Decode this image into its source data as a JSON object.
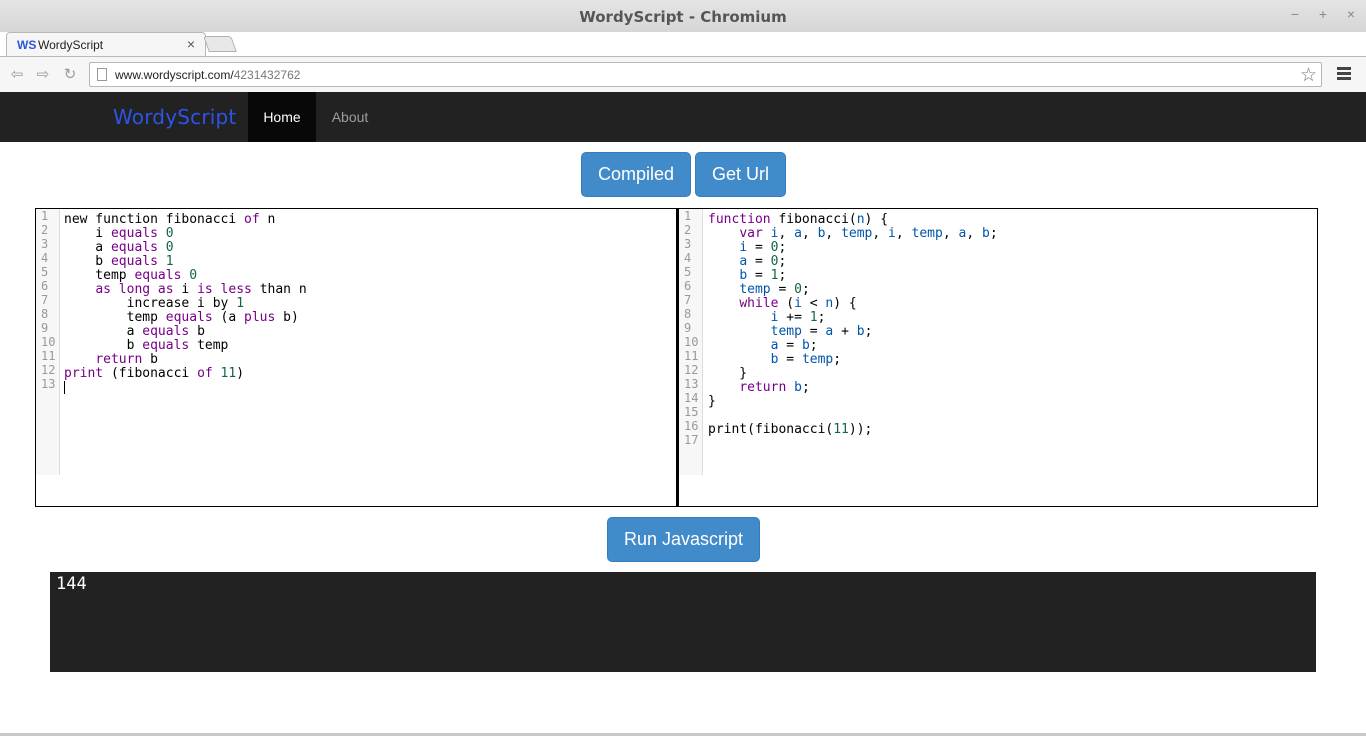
{
  "window": {
    "title": "WordyScript - Chromium",
    "minimize": "−",
    "maximize": "+",
    "close": "×"
  },
  "browser": {
    "tab": {
      "favicon_text": "WS",
      "label": "WordyScript",
      "close": "×"
    },
    "url_host": "www.wordyscript.com/",
    "url_path": "4231432762",
    "back": "⇦",
    "forward": "⇨",
    "reload": "↻",
    "star": "☆"
  },
  "site": {
    "brand": "WordyScript",
    "nav": {
      "home": "Home",
      "about": "About"
    }
  },
  "toolbar": {
    "compiled_label": "Compiled",
    "get_url_label": "Get Url",
    "run_label": "Run Javascript"
  },
  "source_editor": {
    "line_numbers": [
      "1",
      "2",
      "3",
      "4",
      "5",
      "6",
      "7",
      "8",
      "9",
      "10",
      "11",
      "12",
      "13"
    ],
    "lines": [
      [
        {
          "t": "new function fibonacci "
        },
        {
          "t": "of",
          "c": "kw"
        },
        {
          "t": " n"
        }
      ],
      [
        {
          "t": "    i "
        },
        {
          "t": "equals",
          "c": "kw"
        },
        {
          "t": " "
        },
        {
          "t": "0",
          "c": "num"
        }
      ],
      [
        {
          "t": "    a "
        },
        {
          "t": "equals",
          "c": "kw"
        },
        {
          "t": " "
        },
        {
          "t": "0",
          "c": "num"
        }
      ],
      [
        {
          "t": "    b "
        },
        {
          "t": "equals",
          "c": "kw"
        },
        {
          "t": " "
        },
        {
          "t": "1",
          "c": "num"
        }
      ],
      [
        {
          "t": "    temp "
        },
        {
          "t": "equals",
          "c": "kw"
        },
        {
          "t": " "
        },
        {
          "t": "0",
          "c": "num"
        }
      ],
      [
        {
          "t": "    "
        },
        {
          "t": "as long as",
          "c": "kw"
        },
        {
          "t": " i "
        },
        {
          "t": "is less",
          "c": "kw"
        },
        {
          "t": " than n"
        }
      ],
      [
        {
          "t": "        increase i by "
        },
        {
          "t": "1",
          "c": "num"
        }
      ],
      [
        {
          "t": "        temp "
        },
        {
          "t": "equals",
          "c": "kw"
        },
        {
          "t": " (a "
        },
        {
          "t": "plus",
          "c": "kw"
        },
        {
          "t": " b)"
        }
      ],
      [
        {
          "t": "        a "
        },
        {
          "t": "equals",
          "c": "kw"
        },
        {
          "t": " b"
        }
      ],
      [
        {
          "t": "        b "
        },
        {
          "t": "equals",
          "c": "kw"
        },
        {
          "t": " temp"
        }
      ],
      [
        {
          "t": "    "
        },
        {
          "t": "return",
          "c": "kw"
        },
        {
          "t": " b"
        }
      ],
      [
        {
          "t": "print",
          "c": "kw"
        },
        {
          "t": " (fibonacci "
        },
        {
          "t": "of",
          "c": "kw"
        },
        {
          "t": " "
        },
        {
          "t": "11",
          "c": "num"
        },
        {
          "t": ")"
        }
      ],
      []
    ]
  },
  "compiled_editor": {
    "line_numbers": [
      "1",
      "2",
      "3",
      "4",
      "5",
      "6",
      "7",
      "8",
      "9",
      "10",
      "11",
      "12",
      "13",
      "14",
      "15",
      "16",
      "17"
    ],
    "lines": [
      [
        {
          "t": "function",
          "c": "kw"
        },
        {
          "t": " fibonacci("
        },
        {
          "t": "n",
          "c": "vr"
        },
        {
          "t": ") {"
        }
      ],
      [
        {
          "t": "    "
        },
        {
          "t": "var",
          "c": "kw"
        },
        {
          "t": " "
        },
        {
          "t": "i",
          "c": "vr"
        },
        {
          "t": ", "
        },
        {
          "t": "a",
          "c": "vr"
        },
        {
          "t": ", "
        },
        {
          "t": "b",
          "c": "vr"
        },
        {
          "t": ", "
        },
        {
          "t": "temp",
          "c": "vr"
        },
        {
          "t": ", "
        },
        {
          "t": "i",
          "c": "vr"
        },
        {
          "t": ", "
        },
        {
          "t": "temp",
          "c": "vr"
        },
        {
          "t": ", "
        },
        {
          "t": "a",
          "c": "vr"
        },
        {
          "t": ", "
        },
        {
          "t": "b",
          "c": "vr"
        },
        {
          "t": ";"
        }
      ],
      [
        {
          "t": "    "
        },
        {
          "t": "i",
          "c": "vr"
        },
        {
          "t": " = "
        },
        {
          "t": "0",
          "c": "num"
        },
        {
          "t": ";"
        }
      ],
      [
        {
          "t": "    "
        },
        {
          "t": "a",
          "c": "vr"
        },
        {
          "t": " = "
        },
        {
          "t": "0",
          "c": "num"
        },
        {
          "t": ";"
        }
      ],
      [
        {
          "t": "    "
        },
        {
          "t": "b",
          "c": "vr"
        },
        {
          "t": " = "
        },
        {
          "t": "1",
          "c": "num"
        },
        {
          "t": ";"
        }
      ],
      [
        {
          "t": "    "
        },
        {
          "t": "temp",
          "c": "vr"
        },
        {
          "t": " = "
        },
        {
          "t": "0",
          "c": "num"
        },
        {
          "t": ";"
        }
      ],
      [
        {
          "t": "    "
        },
        {
          "t": "while",
          "c": "kw"
        },
        {
          "t": " ("
        },
        {
          "t": "i",
          "c": "vr"
        },
        {
          "t": " < "
        },
        {
          "t": "n",
          "c": "vr"
        },
        {
          "t": ") {"
        }
      ],
      [
        {
          "t": "        "
        },
        {
          "t": "i",
          "c": "vr"
        },
        {
          "t": " += "
        },
        {
          "t": "1",
          "c": "num"
        },
        {
          "t": ";"
        }
      ],
      [
        {
          "t": "        "
        },
        {
          "t": "temp",
          "c": "vr"
        },
        {
          "t": " = "
        },
        {
          "t": "a",
          "c": "vr"
        },
        {
          "t": " + "
        },
        {
          "t": "b",
          "c": "vr"
        },
        {
          "t": ";"
        }
      ],
      [
        {
          "t": "        "
        },
        {
          "t": "a",
          "c": "vr"
        },
        {
          "t": " = "
        },
        {
          "t": "b",
          "c": "vr"
        },
        {
          "t": ";"
        }
      ],
      [
        {
          "t": "        "
        },
        {
          "t": "b",
          "c": "vr"
        },
        {
          "t": " = "
        },
        {
          "t": "temp",
          "c": "vr"
        },
        {
          "t": ";"
        }
      ],
      [
        {
          "t": "    }"
        }
      ],
      [
        {
          "t": "    "
        },
        {
          "t": "return",
          "c": "kw"
        },
        {
          "t": " "
        },
        {
          "t": "b",
          "c": "vr"
        },
        {
          "t": ";"
        }
      ],
      [
        {
          "t": "}"
        }
      ],
      [],
      [
        {
          "t": "print(fibonacci("
        },
        {
          "t": "11",
          "c": "num"
        },
        {
          "t": "));"
        }
      ],
      []
    ]
  },
  "output": {
    "text": "144"
  },
  "colors": {
    "keyword": "#770088",
    "number": "#116644",
    "variable": "#0055aa",
    "button": "#428bca",
    "navbar": "#222222",
    "brand": "#2c55e8"
  }
}
